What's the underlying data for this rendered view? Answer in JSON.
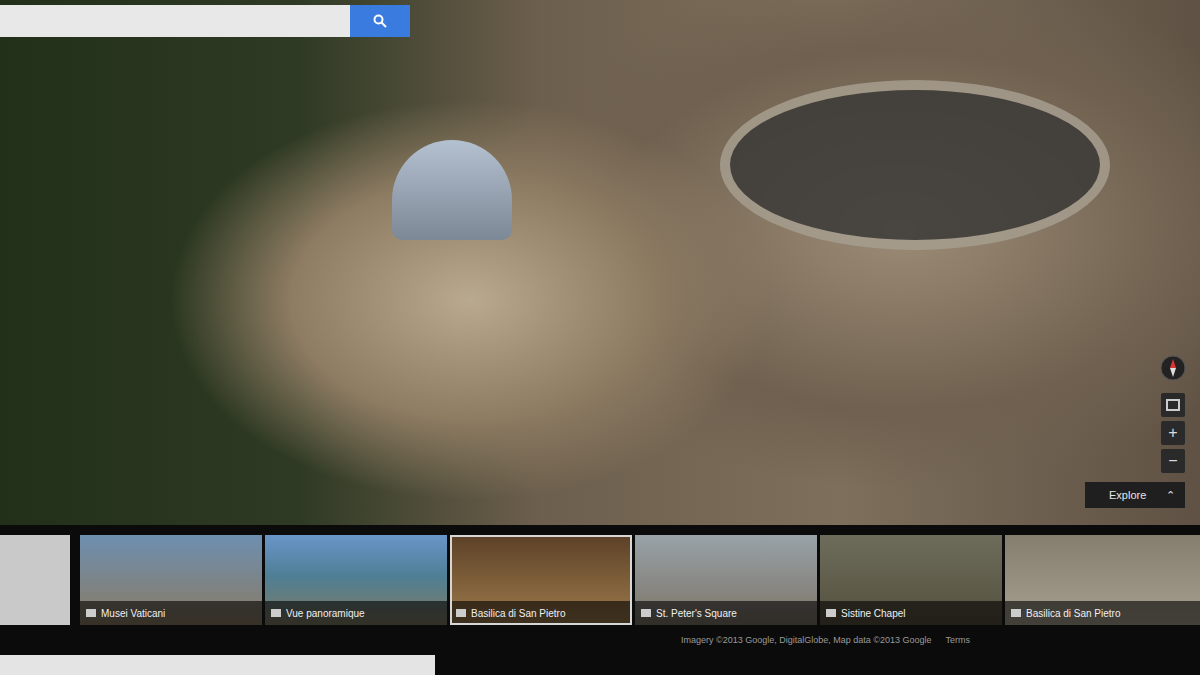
{
  "search": {
    "value": ""
  },
  "map_controls": {
    "zoom_in": "+",
    "zoom_out": "−",
    "explore": "Explore",
    "explore_arrow": "⌃"
  },
  "thumbnails": [
    {
      "label": "",
      "selected": false
    },
    {
      "label": "Musei Vaticani",
      "selected": false
    },
    {
      "label": "Vue panoramique",
      "selected": false
    },
    {
      "label": "Basilica di San Pietro",
      "selected": true
    },
    {
      "label": "St. Peter's Square",
      "selected": false
    },
    {
      "label": "Sistine Chapel",
      "selected": false
    },
    {
      "label": "Basilica di San Pietro",
      "selected": false
    }
  ],
  "attribution": "Imagery ©2013 Google, DigitalGlobe, Map data ©2013 Google",
  "terms": "Terms"
}
